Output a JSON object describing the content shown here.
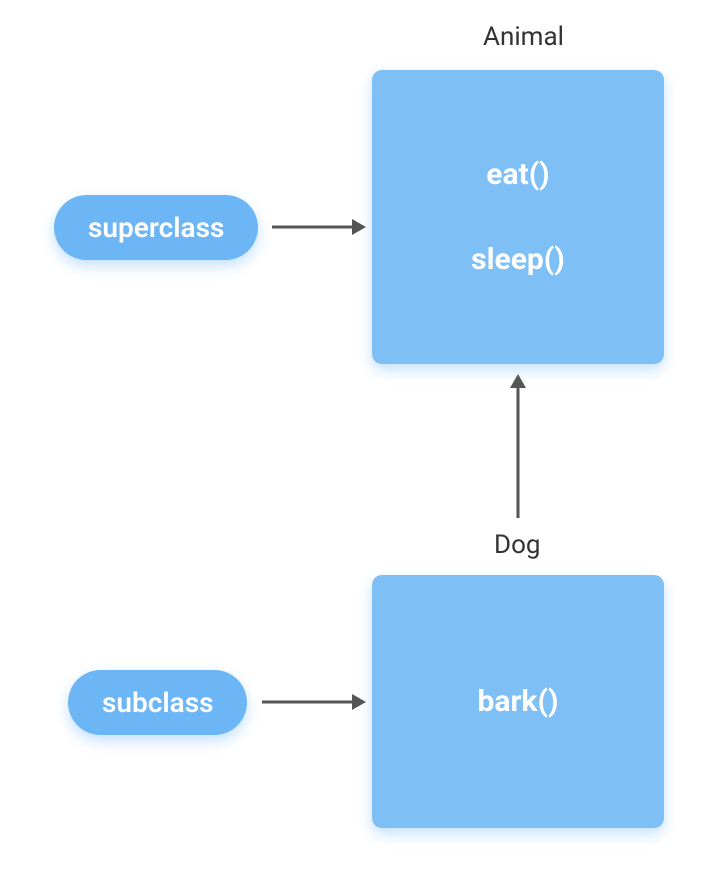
{
  "superclass": {
    "pill_label": "superclass",
    "class_name": "Animal",
    "methods": [
      "eat()",
      "sleep()"
    ]
  },
  "subclass": {
    "pill_label": "subclass",
    "class_name": "Dog",
    "methods": [
      "bark()"
    ]
  },
  "colors": {
    "pill_bg": "#6cb6f5",
    "box_bg": "#7ec0f6",
    "text_white": "#ffffff",
    "text_dark": "#333333",
    "arrow": "#555555"
  }
}
